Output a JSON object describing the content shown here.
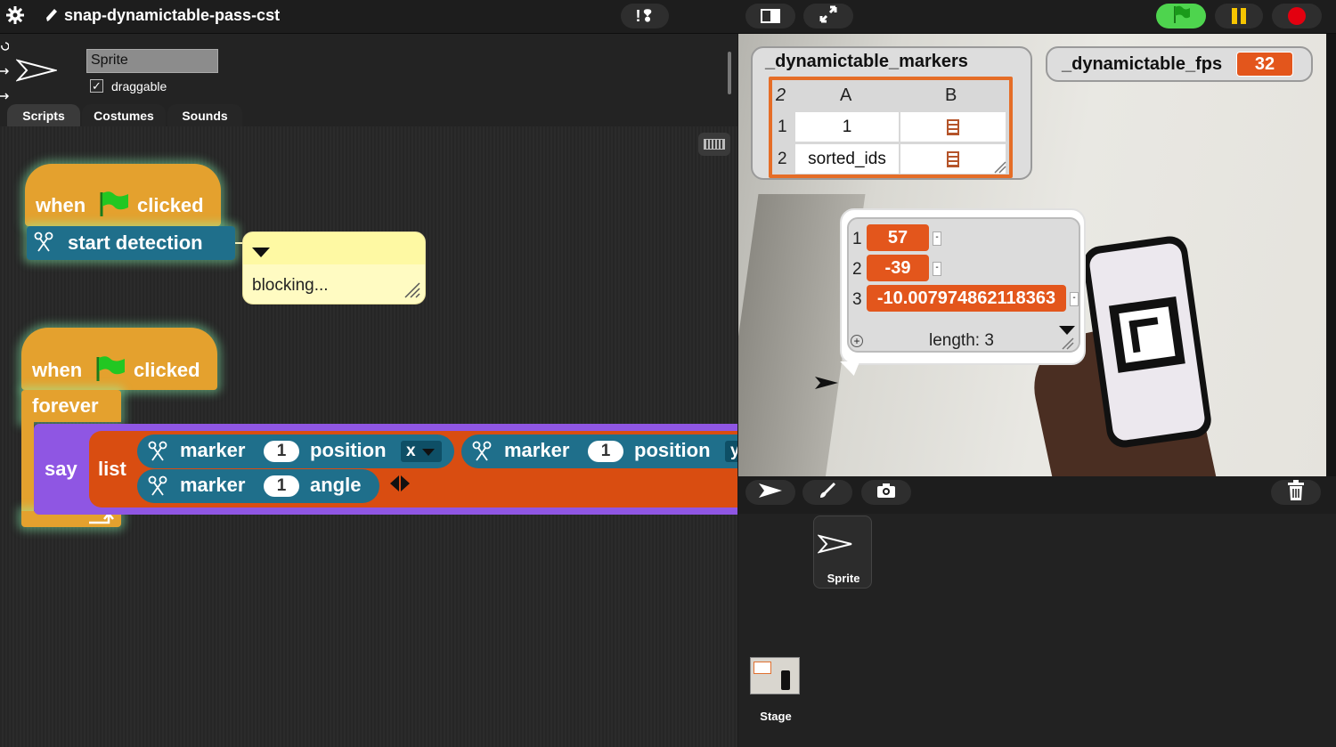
{
  "project": {
    "title": "snap-dynamictable-pass-cst"
  },
  "topbar": {
    "settings_icon": "gear-icon",
    "title_icon": "pencil-icon",
    "stage_controls": [
      "stage-size-icon",
      "fullscreen-icon"
    ],
    "run_controls": [
      "green-flag-icon",
      "pause-icon",
      "stop-icon"
    ],
    "colors": {
      "flag_bg": "#4ed44e",
      "pause": "#f6c500",
      "stop": "#e3000f"
    }
  },
  "sprite": {
    "name": "Sprite",
    "draggable_label": "draggable",
    "draggable_checked": true,
    "draggable_mark": "✓"
  },
  "tabs": [
    {
      "label": "Scripts",
      "active": true
    },
    {
      "label": "Costumes",
      "active": false
    },
    {
      "label": "Sounds",
      "active": false
    }
  ],
  "scripts": {
    "script1": {
      "hat": {
        "when": "when",
        "clicked": "clicked"
      },
      "command": "start detection",
      "comment": {
        "text": "blocking..."
      }
    },
    "script2": {
      "hat": {
        "when": "when",
        "clicked": "clicked"
      },
      "forever": "forever",
      "say": "say",
      "list": "list",
      "reporters": [
        {
          "word1": "marker",
          "slot": "1",
          "word2": "position",
          "dropdown": "x"
        },
        {
          "word1": "marker",
          "slot": "1",
          "word2": "position",
          "dropdown": "y"
        },
        {
          "word1": "marker",
          "slot": "1",
          "word2": "angle"
        }
      ]
    },
    "colors": {
      "control": "#e4a12e",
      "looks": "#8f56e3",
      "lists": "#d94d11",
      "extension": "#1f6f8b"
    }
  },
  "stage": {
    "markers_watcher": {
      "name": "_dynamictable_markers",
      "corner": "2",
      "columns": [
        "A",
        "B"
      ],
      "rows": [
        {
          "index": "1",
          "a": "1"
        },
        {
          "index": "2",
          "a": "sorted_ids"
        }
      ]
    },
    "fps_watcher": {
      "name": "_dynamictable_fps",
      "value": "32"
    },
    "speech_list": {
      "items": [
        {
          "index": "1",
          "value": "57"
        },
        {
          "index": "2",
          "value": "-39"
        },
        {
          "index": "3",
          "value": "-10.007974862118363"
        }
      ],
      "length_label": "length: 3"
    }
  },
  "corral": {
    "tools": [
      "arrow-icon",
      "paintbrush-icon",
      "camera-icon",
      "trash-icon"
    ],
    "sprites": [
      {
        "label": "Sprite"
      }
    ],
    "stage_label": "Stage"
  }
}
